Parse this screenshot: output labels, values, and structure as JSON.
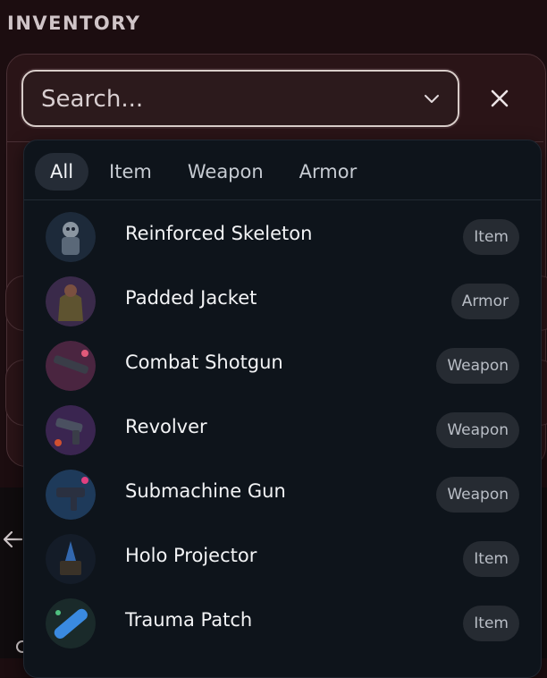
{
  "section_title": "INVENTORY",
  "search": {
    "placeholder": "Search...",
    "value": ""
  },
  "filter_tabs": [
    {
      "label": "All",
      "active": true
    },
    {
      "label": "Item",
      "active": false
    },
    {
      "label": "Weapon",
      "active": false
    },
    {
      "label": "Armor",
      "active": false
    }
  ],
  "results": [
    {
      "name": "Reinforced Skeleton",
      "type": "Item"
    },
    {
      "name": "Padded Jacket",
      "type": "Armor"
    },
    {
      "name": "Combat Shotgun",
      "type": "Weapon"
    },
    {
      "name": "Revolver",
      "type": "Weapon"
    },
    {
      "name": "Submachine Gun",
      "type": "Weapon"
    },
    {
      "name": "Holo Projector",
      "type": "Item"
    },
    {
      "name": "Trauma Patch",
      "type": "Item"
    }
  ],
  "colors": {
    "background": "#1c0d10",
    "dropdown": "#0e141b",
    "active_tab": "#252c36",
    "badge": "#262b32"
  },
  "icons": [
    "chevron-down-icon",
    "close-icon",
    "back-arrow-icon",
    "refresh-icon"
  ]
}
